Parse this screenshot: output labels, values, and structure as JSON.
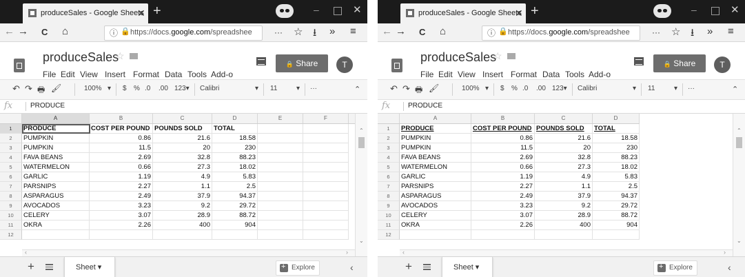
{
  "browser": {
    "tab_title": "produceSales - Google Sheets",
    "tab_close": "✕",
    "new_tab": "+",
    "minimize": "–",
    "close": "✕",
    "nav": {
      "back": "←",
      "forward": "→",
      "reload": "C",
      "home": "⌂"
    },
    "url_info": "ⓘ",
    "url_lock": "🔒",
    "url_prefix": "https://docs.",
    "url_domain": "google.com",
    "url_suffix": "/spreadshee",
    "more_actions": "···",
    "bookmark": "☆",
    "download": "⭳",
    "overflow": "»",
    "hamburger": "≡"
  },
  "sheets": {
    "title": "produceSales",
    "star": "☆",
    "menu": [
      "File",
      "Edit",
      "View",
      "Insert",
      "Format",
      "Data",
      "Tools",
      "Add-o"
    ],
    "share_label": "Share",
    "share_lock": "🔒",
    "avatar_letter": "T",
    "toolbar": {
      "undo": "↶",
      "redo": "↷",
      "print": "🖶",
      "paint": "🖌",
      "zoom": "100%",
      "zoom_caret": "▾",
      "currency": "$",
      "percent": "%",
      "dec_decrease": ".0",
      "dec_increase": ".00",
      "more_formats": "123▾",
      "font": "Calibri",
      "font_caret": "▾",
      "font_size": "11",
      "size_caret": "▾",
      "more": "···",
      "collapse": "⌃"
    },
    "formula_icon": "fx",
    "formula_value": "PRODUCE",
    "col_letters_left": [
      "A",
      "B",
      "C",
      "D",
      "E",
      "F"
    ],
    "col_letters_right": [
      "A",
      "B",
      "C",
      "D"
    ],
    "row_numbers": [
      "1",
      "2",
      "3",
      "4",
      "5",
      "6",
      "7",
      "8",
      "9",
      "10",
      "11",
      "12"
    ],
    "table": {
      "headers": [
        "PRODUCE",
        "COST PER POUND",
        "POUNDS SOLD",
        "TOTAL"
      ],
      "rows": [
        [
          "PUMPKIN",
          "0.86",
          "21.6",
          "18.58"
        ],
        [
          "PUMPKIN",
          "11.5",
          "20",
          "230"
        ],
        [
          "FAVA BEANS",
          "2.69",
          "32.8",
          "88.23"
        ],
        [
          "WATERMELON",
          "0.66",
          "27.3",
          "18.02"
        ],
        [
          "GARLIC",
          "1.19",
          "4.9",
          "5.83"
        ],
        [
          "PARSNIPS",
          "2.27",
          "1.1",
          "2.5"
        ],
        [
          "ASPARAGUS",
          "2.49",
          "37.9",
          "94.37"
        ],
        [
          "AVOCADOS",
          "3.23",
          "9.2",
          "29.72"
        ],
        [
          "CELERY",
          "3.07",
          "28.9",
          "88.72"
        ],
        [
          "OKRA",
          "2.26",
          "400",
          "904"
        ]
      ]
    },
    "scroll": {
      "up": "⌃",
      "down": "⌄",
      "left": "‹",
      "right": "›"
    },
    "bottom": {
      "add_sheet": "+",
      "sheet_label": "Sheet ▾",
      "explore_label": "Explore",
      "collapse": "‹"
    }
  },
  "colors": {
    "tabbar": "#1b1b1b",
    "share_button": "#6d6d6d",
    "selection": "#5a5a5a"
  }
}
